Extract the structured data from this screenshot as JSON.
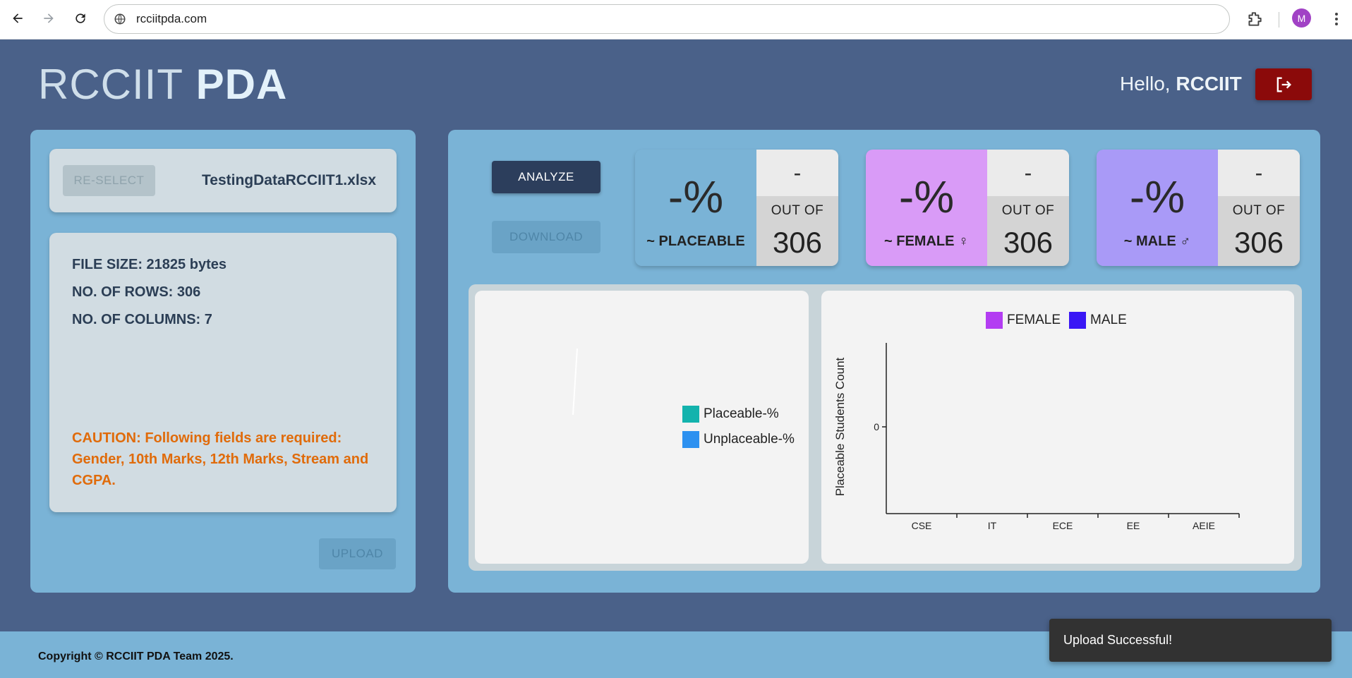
{
  "browser": {
    "url": "rcciitpda.com",
    "profile_initial": "M"
  },
  "header": {
    "brand_thin": "RCCIIT",
    "brand_bold": "PDA",
    "greeting_prefix": "Hello,",
    "greeting_name": "RCCIIT",
    "logout_icon": "logout-icon"
  },
  "upload_panel": {
    "reselect_label": "RE-SELECT",
    "file_name": "TestingDataRCCIIT1.xlsx",
    "file_size": "FILE SIZE: 21825 bytes",
    "rows": "NO. OF ROWS: 306",
    "columns": "NO. OF COLUMNS: 7",
    "caution": "CAUTION: Following fields are required: Gender, 10th Marks, 12th Marks, Stream and CGPA.",
    "upload_label": "UPLOAD"
  },
  "actions": {
    "analyze_label": "ANALYZE",
    "download_label": "DOWNLOAD"
  },
  "stats": [
    {
      "pct": "-%",
      "label": "~ PLACEABLE",
      "count": "-",
      "out_of": "OUT OF",
      "total": "306",
      "color": "#7ab3d6"
    },
    {
      "pct": "-%",
      "label": "~ FEMALE ♀",
      "count": "-",
      "out_of": "OUT OF",
      "total": "306",
      "color": "#d99bf7"
    },
    {
      "pct": "-%",
      "label": "~ MALE ♂",
      "count": "-",
      "out_of": "OUT OF",
      "total": "306",
      "color": "#a99af7"
    }
  ],
  "pie_chart": {
    "legend": [
      {
        "label": "Placeable-%",
        "color": "#13b3ad"
      },
      {
        "label": "Unplaceable-%",
        "color": "#2d91f0"
      }
    ]
  },
  "chart_data": {
    "type": "bar",
    "categories": [
      "CSE",
      "IT",
      "ECE",
      "EE",
      "AEIE"
    ],
    "series": [
      {
        "name": "FEMALE",
        "values": [
          0,
          0,
          0,
          0,
          0
        ],
        "color": "#b33df2"
      },
      {
        "name": "MALE",
        "values": [
          0,
          0,
          0,
          0,
          0
        ],
        "color": "#3a17f5"
      }
    ],
    "ylabel": "Placeable Students Count",
    "yticks": [
      "0"
    ],
    "xlabel": "",
    "legend": "top",
    "grid": false
  },
  "footer": {
    "copyright": "Copyright © RCCIIT PDA Team 2025."
  },
  "toast": {
    "message": "Upload Successful!"
  }
}
